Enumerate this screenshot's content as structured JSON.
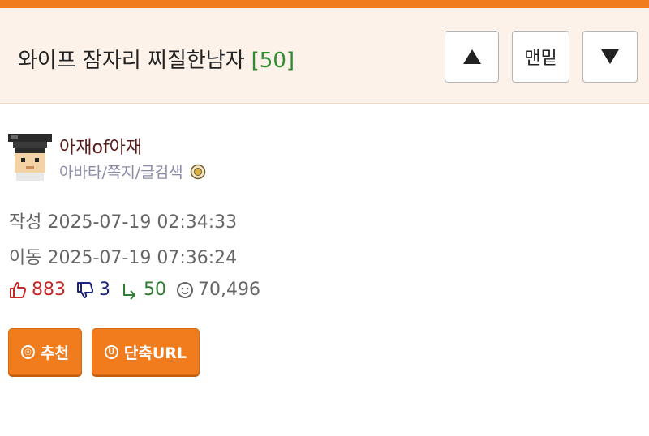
{
  "header": {
    "title": "와이프 잠자리 찌질한남자",
    "comment_count": "[50]",
    "up_icon": "triangle-up-icon",
    "bottom_label": "맨밑",
    "down_icon": "triangle-down-icon"
  },
  "author": {
    "nickname": "아재of아재",
    "links": "아바타/쪽지/글검색",
    "avatar_icon": "pixel-avatar-icon",
    "badge_icon": "medal-icon"
  },
  "meta": {
    "written": "작성 2025-07-19 02:34:33",
    "moved": "이동 2025-07-19 07:36:24"
  },
  "stats": {
    "likes": "883",
    "dislikes": "3",
    "replies": "50",
    "views": "70,496"
  },
  "actions": {
    "recommend_label": "추천",
    "shorturl_label": "단축URL"
  },
  "colors": {
    "accent": "#f07c1e",
    "like": "#c62828",
    "dislike": "#1a237e",
    "reply": "#2e7d32"
  }
}
